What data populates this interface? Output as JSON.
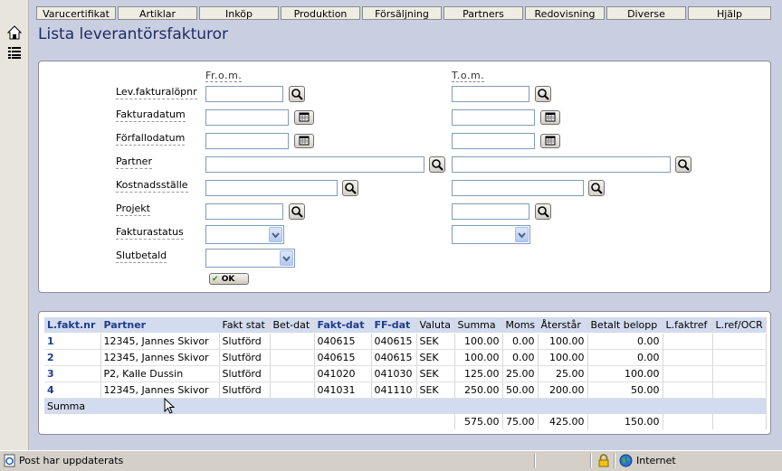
{
  "menu": {
    "items": [
      "Varucertifikat",
      "Artiklar",
      "Inköp",
      "Produktion",
      "Försäljning",
      "Partners",
      "Redovisning",
      "Diverse",
      "Hjälp"
    ]
  },
  "page": {
    "title": "Lista leverantörsfakturor"
  },
  "filter": {
    "from_label": "Fr.o.m.",
    "to_label": "T.o.m.",
    "fields": {
      "levfakt": "Lev.fakturalöpnr",
      "fakturadatum": "Fakturadatum",
      "forfallodatum": "Förfallodatum",
      "partner": "Partner",
      "kostnadsstalle": "Kostnadsställe",
      "projekt": "Projekt",
      "fakturastatus": "Fakturastatus",
      "slutbetald": "Slutbetald"
    },
    "ok_label": "OK"
  },
  "table": {
    "headers": [
      "L.fakt.nr",
      "Partner",
      "Fakt stat",
      "Bet-dat",
      "Fakt-dat",
      "FF-dat",
      "Valuta",
      "Summa",
      "Moms",
      "Återstår",
      "Betalt belopp",
      "L.faktref",
      "L.ref/OCR"
    ],
    "rows": [
      [
        "1",
        "12345, Jannes Skivor",
        "Slutförd",
        "",
        "040615",
        "040615",
        "SEK",
        "100.00",
        "0.00",
        "100.00",
        "0.00",
        "",
        ""
      ],
      [
        "2",
        "12345, Jannes Skivor",
        "Slutförd",
        "",
        "040615",
        "040615",
        "SEK",
        "100.00",
        "0.00",
        "100.00",
        "0.00",
        "",
        ""
      ],
      [
        "3",
        "P2, Kalle Dussin",
        "Slutförd",
        "",
        "041020",
        "041030",
        "SEK",
        "125.00",
        "25.00",
        "25.00",
        "100.00",
        "",
        ""
      ],
      [
        "4",
        "12345, Jannes Skivor",
        "Slutförd",
        "",
        "041031",
        "041110",
        "SEK",
        "250.00",
        "50.00",
        "200.00",
        "50.00",
        "",
        ""
      ]
    ],
    "sum_label": "Summa",
    "totals": {
      "summa": "575.00",
      "moms": "75.00",
      "aterstar": "425.00",
      "betalt": "150.00"
    }
  },
  "status": {
    "text": "Post har uppdaterats",
    "zone": "Internet"
  },
  "colors": {
    "accent": "#1e3c8c",
    "panel_bg": "#c9cfe0",
    "header_bg": "#d3dbef"
  }
}
